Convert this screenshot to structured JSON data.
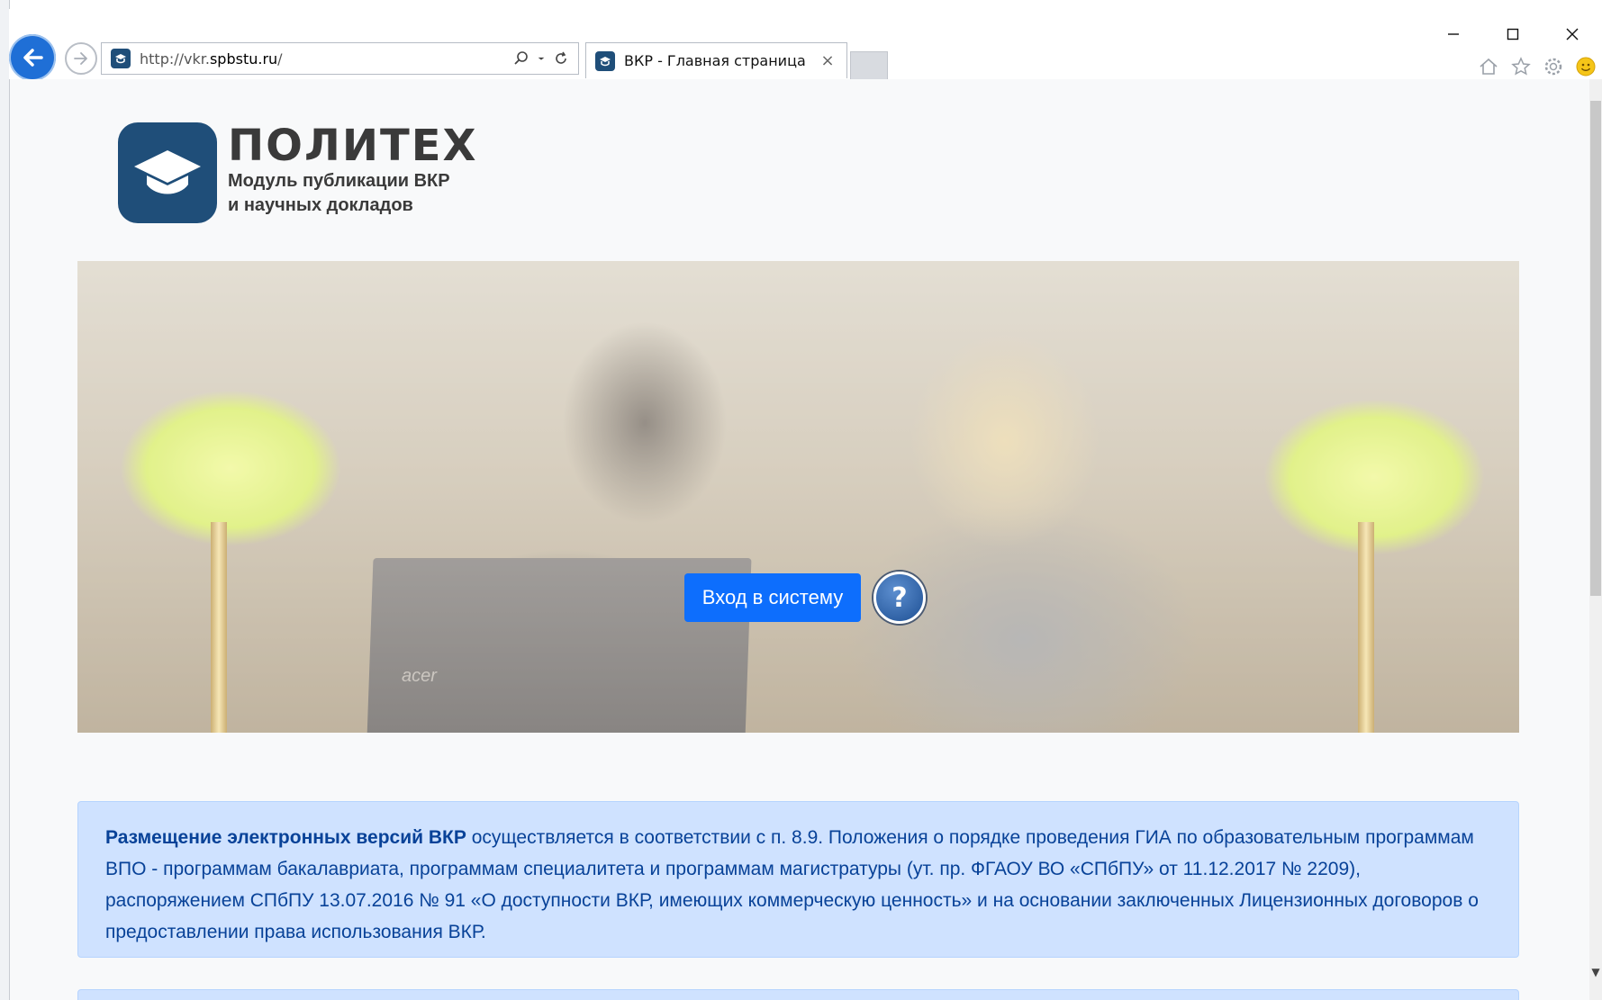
{
  "browser": {
    "url_prefix": "http://vkr.",
    "url_domain": "spbstu.ru",
    "url_suffix": "/",
    "tab_title": "ВКР - Главная страница",
    "tab_close": "×"
  },
  "logo": {
    "title": "ПОЛИТЕХ",
    "subtitle_line1": "Модуль публикации ВКР",
    "subtitle_line2": "и научных докладов"
  },
  "hero": {
    "login_label": "Вход в систему",
    "help_label": "?",
    "laptop_brand": "acer"
  },
  "info": {
    "bold_lead": "Размещение электронных версий ВКР",
    "text": " осуществляется в соответствии с п. 8.9. Положения о порядке проведения ГИА по образовательным программам ВПО - программам бакалавриата, программам специалитета и программам магистратуры (ут. пр. ФГАОУ ВО «СПбПУ» от 11.12.2017 № 2209), распоряжением СПбПУ 13.07.2016 № 91 «О доступности ВКР, имеющих коммерческую ценность» и на основании заключенных Лицензионных договоров о предоставлении права использования ВКР."
  },
  "colors": {
    "accent": "#0d6efd",
    "brand": "#1f4e79",
    "alert_bg": "#cfe2ff",
    "alert_text": "#084298"
  },
  "icons": [
    "back-arrow-icon",
    "forward-arrow-icon",
    "site-favicon-icon",
    "search-icon",
    "dropdown-icon",
    "refresh-icon",
    "home-icon",
    "favorites-star-icon",
    "settings-gear-icon",
    "smiley-feedback-icon",
    "minimize-icon",
    "maximize-icon",
    "close-icon"
  ]
}
